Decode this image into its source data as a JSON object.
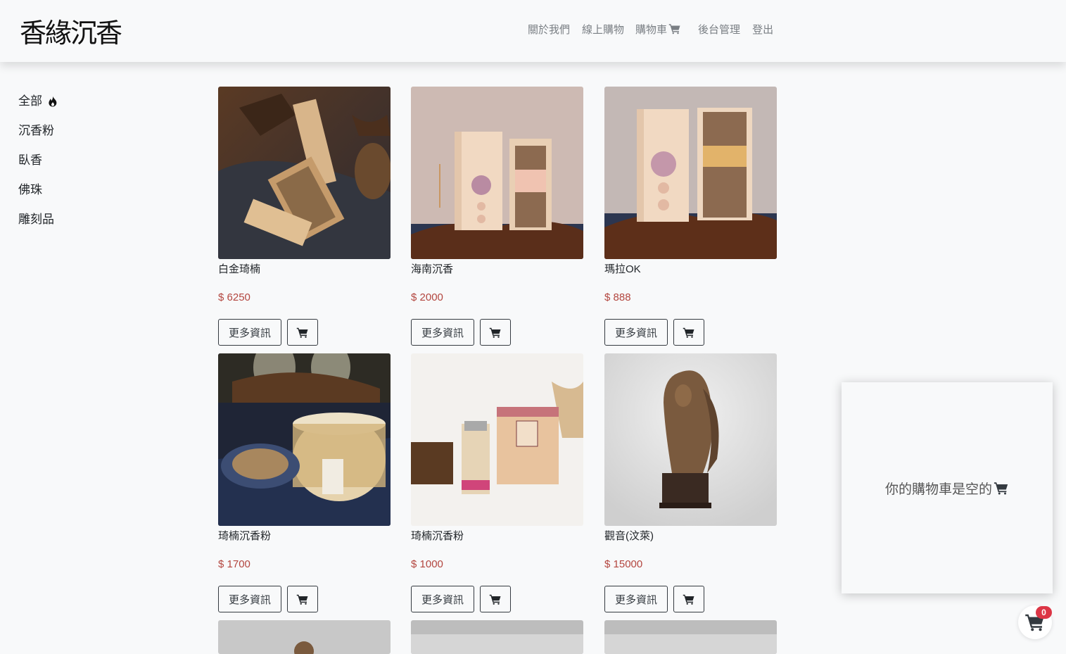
{
  "brand": {
    "name": "香緣沉香"
  },
  "nav": {
    "about": "關於我們",
    "shop": "線上購物",
    "cart": "購物車",
    "admin": "後台管理",
    "logout": "登出"
  },
  "sidebar": {
    "items": [
      {
        "label": "全部",
        "icon": "fire-icon"
      },
      {
        "label": "沉香粉"
      },
      {
        "label": "臥香"
      },
      {
        "label": "佛珠"
      },
      {
        "label": "雕刻品"
      }
    ]
  },
  "products": [
    {
      "name": "白金琦楠",
      "price": "$ 6250",
      "more_label": "更多資訊"
    },
    {
      "name": "海南沉香",
      "price": "$ 2000",
      "more_label": "更多資訊"
    },
    {
      "name": "瑪拉OK",
      "price": "$ 888",
      "more_label": "更多資訊"
    },
    {
      "name": "琦楠沉香粉",
      "price": "$ 1700",
      "more_label": "更多資訊"
    },
    {
      "name": "琦楠沉香粉",
      "price": "$ 1000",
      "more_label": "更多資訊"
    },
    {
      "name": "觀音(汶萊)",
      "price": "$ 15000",
      "more_label": "更多資訊"
    }
  ],
  "cart_panel": {
    "empty_text": "你的購物車是空的"
  },
  "cart_badge": {
    "count": "0"
  },
  "colors": {
    "price": "#b3463f",
    "badge": "#dc3545"
  }
}
